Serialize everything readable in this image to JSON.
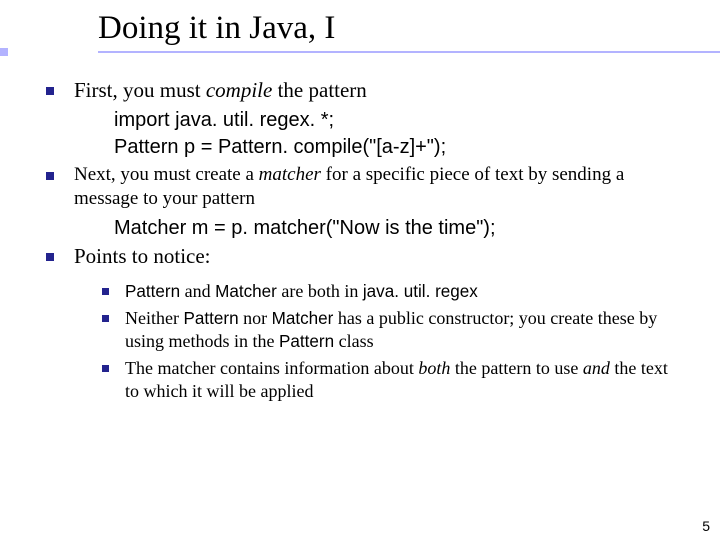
{
  "title": "Doing it in Java, I",
  "p1": {
    "pre": "First, you must ",
    "em": "compile",
    "post": " the pattern"
  },
  "code1a": "import java. util. regex. *;",
  "code1b": "Pattern p = Pattern. compile(\"[a-z]+\");",
  "p2": {
    "pre": "Next, you must create a ",
    "em": "matcher",
    "post": " for a specific piece of text by sending a message to your pattern"
  },
  "code2": "Matcher m = p. matcher(\"Now is the time\");",
  "p3": "Points to notice:",
  "s1": {
    "a": "Pattern",
    "b": " and ",
    "c": "Matcher",
    "d": " are both in ",
    "e": "java. util. regex"
  },
  "s2": {
    "a": "Neither ",
    "b": "Pattern",
    "c": " nor ",
    "d": "Matcher",
    "e": " has a public constructor; you create these by using methods in the ",
    "f": "Pattern",
    "g": " class"
  },
  "s3": {
    "a": "The matcher contains information about ",
    "b": "both",
    "c": " the pattern to use ",
    "d": "and",
    "e": " the text to which it will be applied"
  },
  "page": "5"
}
